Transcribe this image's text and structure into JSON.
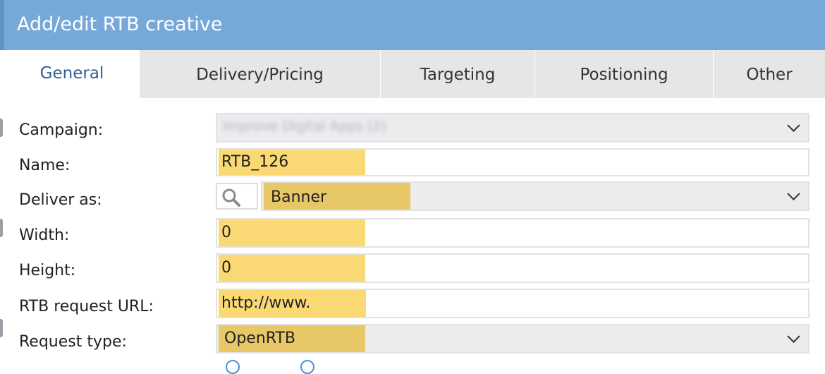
{
  "dialog": {
    "title": "Add/edit RTB creative"
  },
  "tabs": [
    {
      "label": "General",
      "active": true
    },
    {
      "label": "Delivery/Pricing",
      "active": false
    },
    {
      "label": "Targeting",
      "active": false
    },
    {
      "label": "Positioning",
      "active": false
    },
    {
      "label": "Other",
      "active": false
    }
  ],
  "form": {
    "campaign": {
      "label": "Campaign:",
      "value": "Improve Digital Apps (2)"
    },
    "name": {
      "label": "Name:",
      "value": "RTB_126"
    },
    "deliver_as": {
      "label": "Deliver as:",
      "value": "Banner",
      "search_icon": "search-icon"
    },
    "width": {
      "label": "Width:",
      "value": "0"
    },
    "height": {
      "label": "Height:",
      "value": "0"
    },
    "rtb_request_url": {
      "label": "RTB request URL:",
      "value": "http://www."
    },
    "request_type": {
      "label": "Request type:",
      "value": "OpenRTB"
    }
  },
  "colors": {
    "titlebar": "#76a8d8",
    "active_tab_text": "#2e5f95",
    "inactive_tab_bg": "#e6e6e6",
    "highlight": "#fad974",
    "highlight_select": "#e8c767"
  }
}
